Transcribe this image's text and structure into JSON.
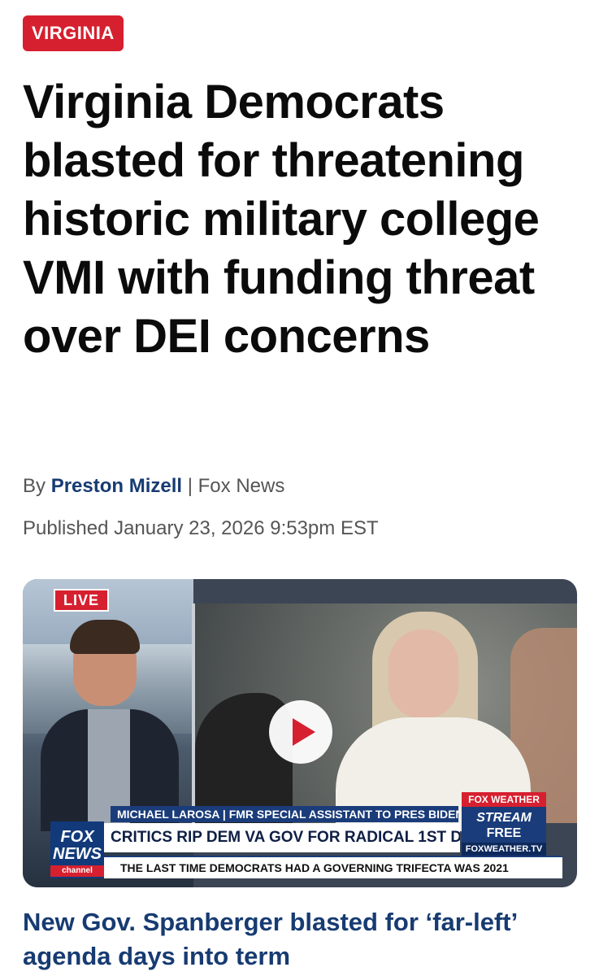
{
  "section_tag": "VIRGINIA",
  "headline": "Virginia Democrats blasted for threatening historic military college VMI with funding threat over DEI concerns",
  "byline": {
    "prefix": "By",
    "author": "Preston Mizell",
    "separator": "|",
    "outlet": "Fox News"
  },
  "published": "Published January 23, 2026 9:53pm EST",
  "video": {
    "live_label": "LIVE",
    "name_bar": "MICHAEL LAROSA | FMR SPECIAL ASSISTANT TO PRES BIDEN",
    "main_bar": "CRITICS RIP DEM VA GOV FOR RADICAL 1ST DAY AGENDA",
    "ticker": "THE LAST TIME DEMOCRATS HAD A GOVERNING TRIFECTA WAS 2021",
    "logo": {
      "line1": "FOX",
      "line2": "NEWS",
      "line3": "channel"
    },
    "weather": {
      "line1": "FOX WEATHER",
      "line2": "STREAM",
      "line3": "FREE",
      "line4": "FOXWEATHER.TV"
    },
    "play_icon": "play-icon"
  },
  "caption": "New Gov. Spanberger blasted for ‘far-left’ agenda days into term",
  "colors": {
    "tag_red": "#d6202f",
    "link_blue": "#173b72"
  }
}
